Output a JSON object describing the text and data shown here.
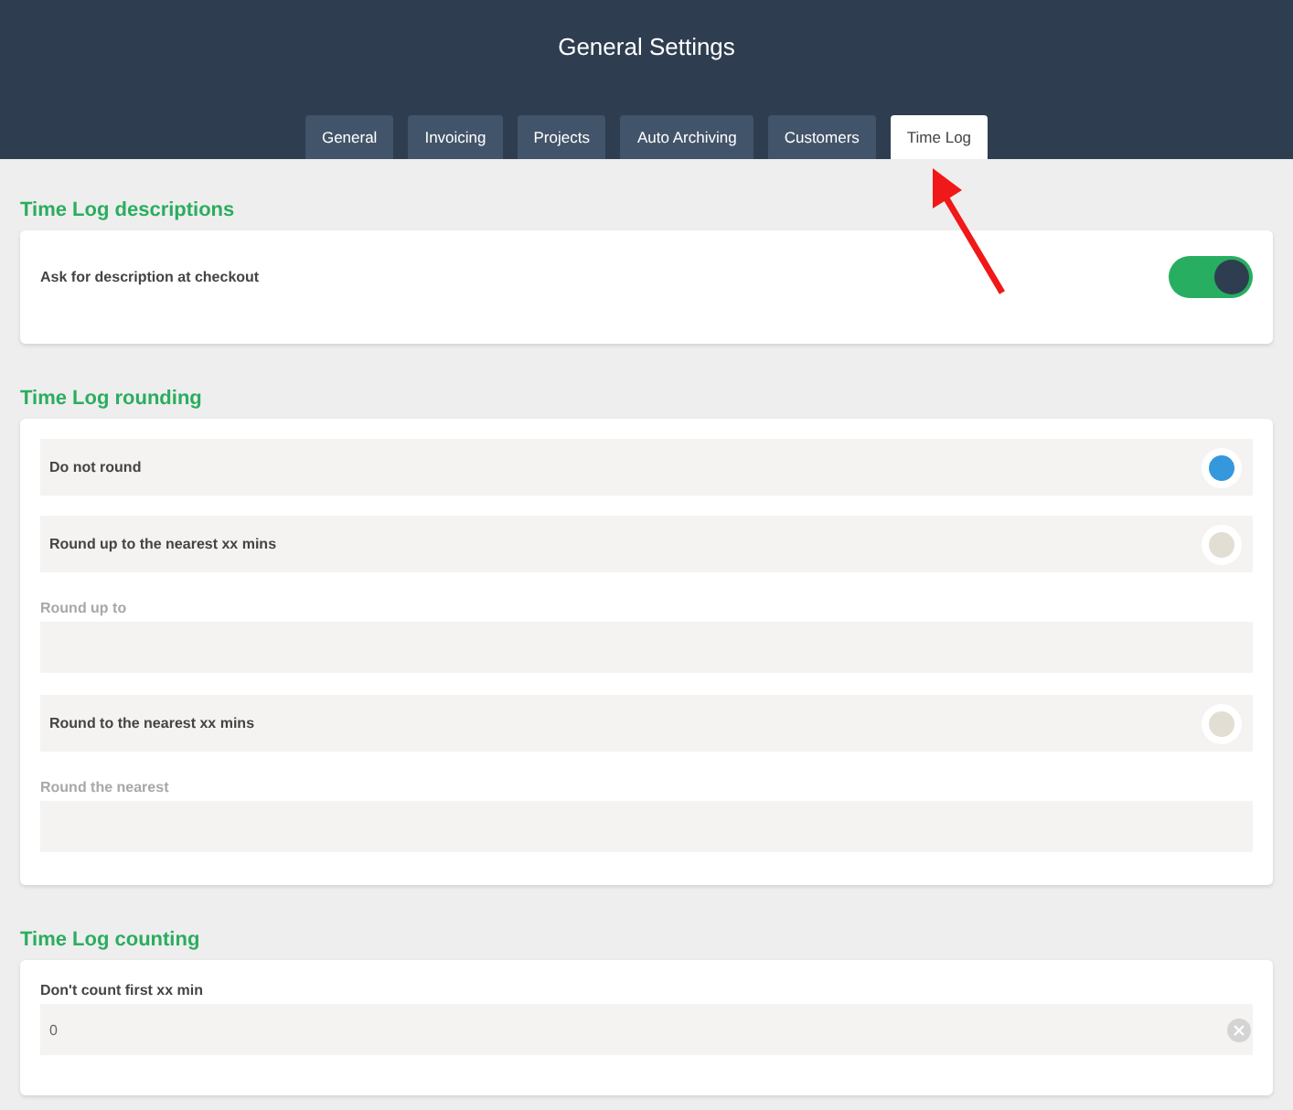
{
  "header": {
    "title": "General Settings"
  },
  "tabs": [
    {
      "label": "General",
      "selected": false
    },
    {
      "label": "Invoicing",
      "selected": false
    },
    {
      "label": "Projects",
      "selected": false
    },
    {
      "label": "Auto Archiving",
      "selected": false
    },
    {
      "label": "Customers",
      "selected": false
    },
    {
      "label": "Time Log",
      "selected": true
    }
  ],
  "sections": [
    {
      "title": "Time Log descriptions",
      "items": [
        {
          "kind": "toggle",
          "label": "Ask for description at checkout",
          "on": true
        }
      ]
    },
    {
      "title": "Time Log rounding",
      "items": [
        {
          "kind": "radio",
          "label": "Do not round",
          "selected": true
        },
        {
          "kind": "radio",
          "label": "Round up to the nearest xx mins",
          "selected": false
        },
        {
          "kind": "field",
          "label": "Round up to",
          "disabled": true
        },
        {
          "kind": "radio",
          "label": "Round to the nearest xx mins",
          "selected": false
        },
        {
          "kind": "field",
          "label": "Round the nearest",
          "disabled": true
        }
      ]
    },
    {
      "title": "Time Log counting",
      "items": [
        {
          "kind": "input",
          "label": "Don't count first xx min",
          "value": "0",
          "disabled": false
        }
      ]
    }
  ]
}
